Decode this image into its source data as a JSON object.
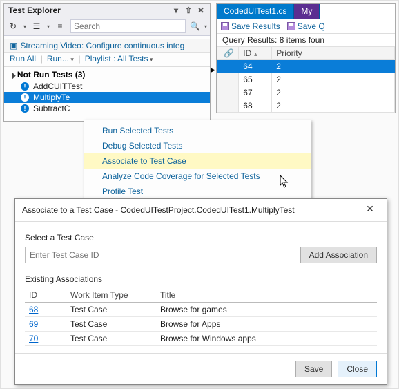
{
  "testExplorer": {
    "title": "Test Explorer",
    "searchPlaceholder": "Search",
    "streaming": "Streaming Video: Configure continuous integ",
    "links": {
      "runAll": "Run All",
      "run": "Run...",
      "playlist": "Playlist : All Tests"
    },
    "group": "Not Run Tests  (3)",
    "items": [
      "AddCUITTest",
      "MultiplyTest",
      "SubtractCUITTest"
    ],
    "itemsVisible": [
      "AddCUITTest",
      "MultiplyTe",
      "SubtractC"
    ]
  },
  "docPanel": {
    "tabActive": "CodedUITest1.cs",
    "tabSecondary": "My",
    "saveResults": "Save Results",
    "saveQ": "Save Q",
    "queryHead": "Query Results: 8 items foun",
    "cols": {
      "id": "ID",
      "priority": "Priority"
    },
    "rows": [
      {
        "id": "64",
        "priority": "2",
        "selected": true
      },
      {
        "id": "65",
        "priority": "2"
      },
      {
        "id": "67",
        "priority": "2"
      },
      {
        "id": "68",
        "priority": "2"
      }
    ]
  },
  "contextMenu": {
    "items": [
      "Run Selected Tests",
      "Debug Selected Tests",
      "Associate to Test Case",
      "Analyze Code Coverage for Selected Tests",
      "Profile Test"
    ],
    "highlightIndex": 2
  },
  "dialog": {
    "title": "Associate to a Test Case - CodedUITestProject.CodedUITest1.MultiplyTest",
    "selectLabel": "Select a Test Case",
    "inputPlaceholder": "Enter Test Case ID",
    "addBtn": "Add Association",
    "existingLabel": "Existing Associations",
    "cols": {
      "id": "ID",
      "type": "Work Item Type",
      "title": "Title"
    },
    "rows": [
      {
        "id": "68",
        "type": "Test Case",
        "title": "Browse for games"
      },
      {
        "id": "69",
        "type": "Test Case",
        "title": "Browse for Apps"
      },
      {
        "id": "70",
        "type": "Test Case",
        "title": "Browse for Windows apps"
      }
    ],
    "save": "Save",
    "close": "Close"
  }
}
